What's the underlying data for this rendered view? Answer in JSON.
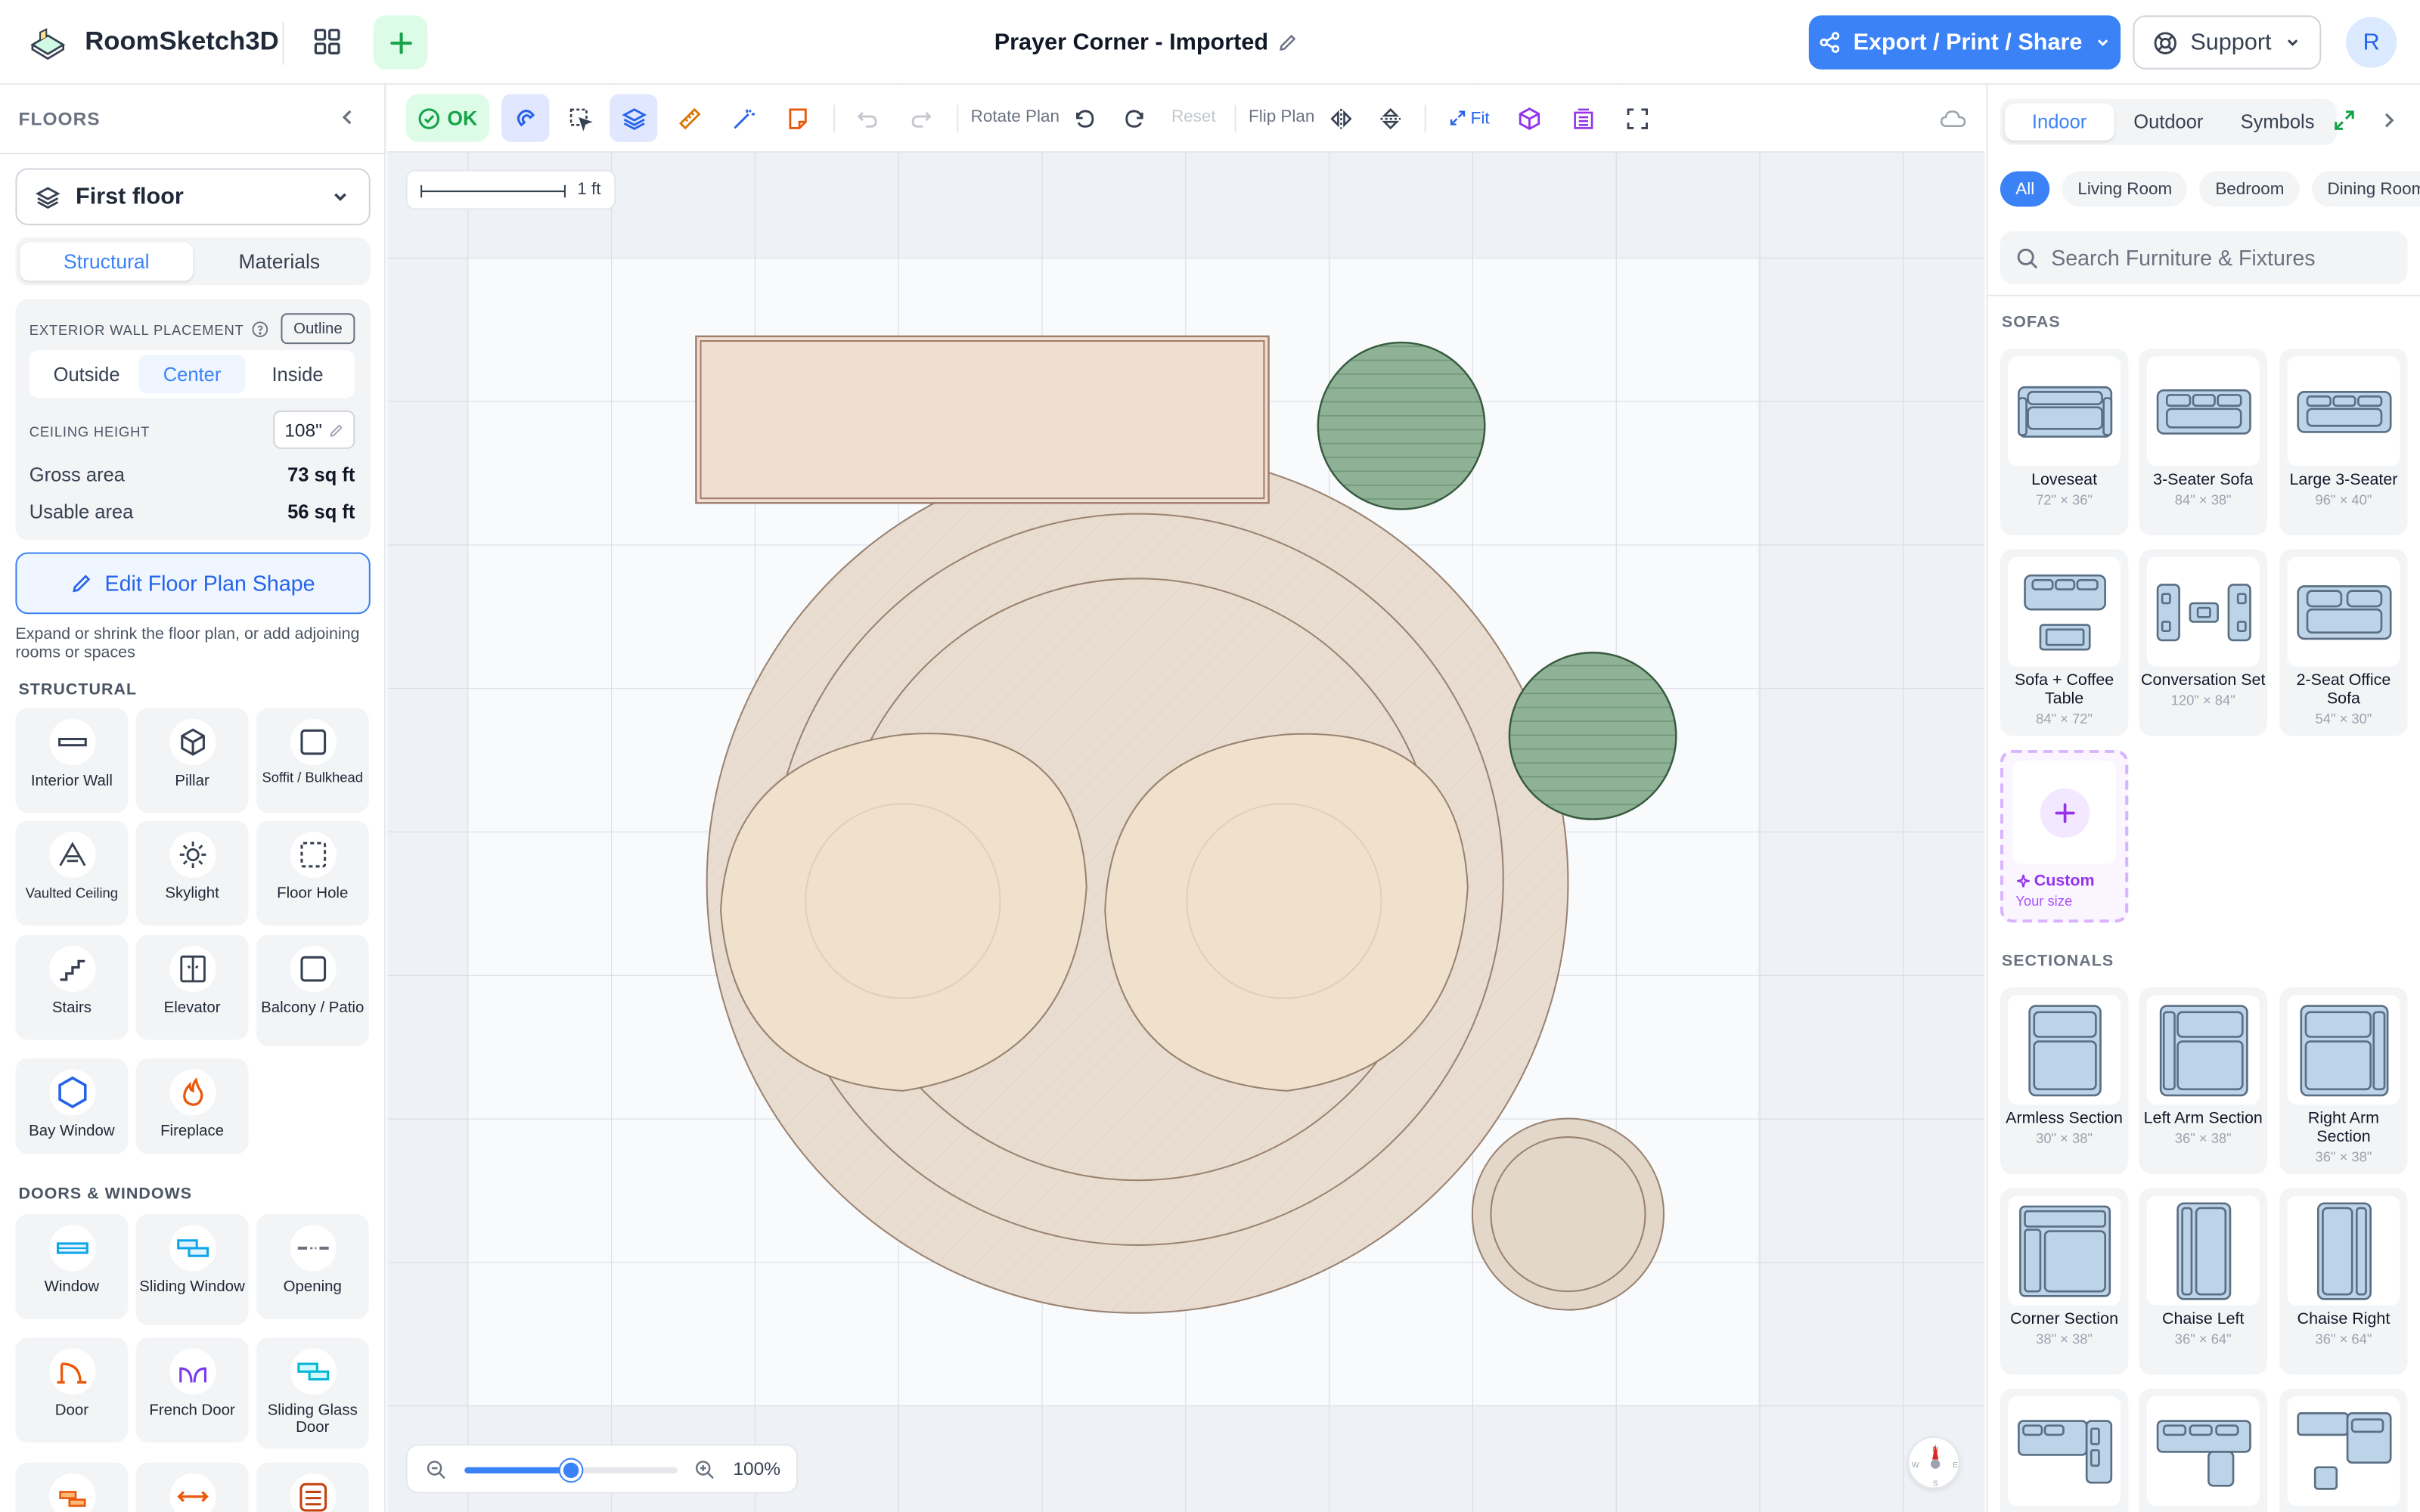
{
  "app": {
    "name": "RoomSketch3D",
    "user_initial": "R"
  },
  "document": {
    "title": "Prayer Corner - Imported"
  },
  "header": {
    "export_label": "Export / Print / Share",
    "support_label": "Support"
  },
  "left_panel": {
    "title": "FLOORS",
    "floor_selected": "First floor",
    "tabs": [
      "Structural",
      "Materials"
    ],
    "active_tab": "Structural",
    "wall_placement_label": "EXTERIOR WALL PLACEMENT",
    "outline_label": "Outline",
    "placement_options": [
      "Outside",
      "Center",
      "Inside"
    ],
    "placement_selected": "Center",
    "ceiling_label": "CEILING HEIGHT",
    "ceiling_value": "108\"",
    "gross_area_label": "Gross area",
    "gross_area_value": "73 sq ft",
    "usable_area_label": "Usable area",
    "usable_area_value": "56 sq ft",
    "edit_shape_label": "Edit Floor Plan Shape",
    "hint": "Expand or shrink the floor plan, or add adjoining rooms or spaces",
    "structural_title": "STRUCTURAL",
    "structural_items": [
      "Interior Wall",
      "Pillar",
      "Soffit / Bulkhead",
      "Vaulted Ceiling",
      "Skylight",
      "Floor Hole",
      "Stairs",
      "Elevator",
      "Balcony / Patio",
      "Bay Window",
      "Fireplace"
    ],
    "doors_title": "DOORS & WINDOWS",
    "door_items": [
      "Window",
      "Sliding Window",
      "Opening",
      "Door",
      "French Door",
      "Sliding Glass Door"
    ]
  },
  "toolbar": {
    "status": "OK",
    "rotate_label": "Rotate Plan",
    "reset_label": "Reset",
    "flip_label": "Flip Plan",
    "fit_label": "Fit"
  },
  "canvas": {
    "scale_label": "1 ft",
    "zoom_percent": "100%",
    "zoom_level": 0.5,
    "compass": {
      "n": "N",
      "w": "W",
      "e": "E",
      "s": "S"
    }
  },
  "right_panel": {
    "tabs": [
      "Indoor",
      "Outdoor",
      "Symbols"
    ],
    "active_tab": "Indoor",
    "chips": [
      "All",
      "Living Room",
      "Bedroom",
      "Dining Room"
    ],
    "active_chip": "All",
    "search_placeholder": "Search Furniture & Fixtures",
    "sofas_title": "SOFAS",
    "sofas": [
      {
        "name": "Loveseat",
        "dim": "72\" × 36\""
      },
      {
        "name": "3-Seater Sofa",
        "dim": "84\" × 38\""
      },
      {
        "name": "Large 3-Seater",
        "dim": "96\" × 40\""
      },
      {
        "name": "Sofa + Coffee Table",
        "dim": "84\" × 72\""
      },
      {
        "name": "Conversation Set",
        "dim": "120\" × 84\""
      },
      {
        "name": "2-Seat Office Sofa",
        "dim": "54\" × 30\""
      }
    ],
    "custom": {
      "name": "Custom",
      "sub": "Your size"
    },
    "sectionals_title": "SECTIONALS",
    "sectionals": [
      {
        "name": "Armless Section",
        "dim": "30\" × 38\""
      },
      {
        "name": "Left Arm Section",
        "dim": "36\" × 38\""
      },
      {
        "name": "Right Arm Section",
        "dim": "36\" × 38\""
      },
      {
        "name": "Corner Section",
        "dim": "38\" × 38\""
      },
      {
        "name": "Chaise Left",
        "dim": "36\" × 64\""
      },
      {
        "name": "Chaise Right",
        "dim": "36\" × 64\""
      }
    ]
  },
  "colors": {
    "accent": "#3b82f6",
    "ok_green": "#16a34a",
    "rug": "#e8ddd0",
    "cushion": "#efe1cc",
    "plant": "#8fb296"
  }
}
